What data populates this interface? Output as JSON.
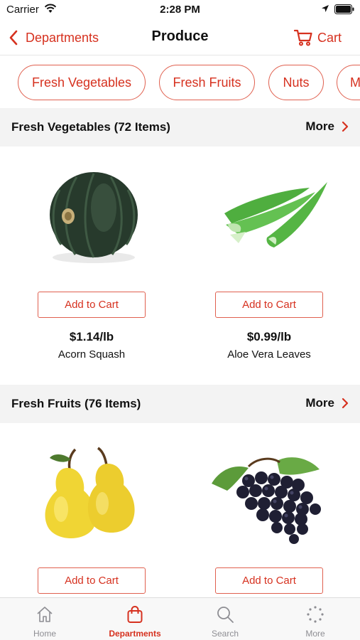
{
  "status": {
    "carrier": "Carrier",
    "time": "2:28 PM"
  },
  "nav": {
    "back_label": "Departments",
    "title": "Produce",
    "cart_label": "Cart"
  },
  "chips": [
    "Fresh Vegetables",
    "Fresh Fruits",
    "Nuts",
    "M"
  ],
  "sections": [
    {
      "title": "Fresh Vegetables (72 Items)",
      "more_label": "More",
      "products": [
        {
          "name": "Acorn Squash",
          "price": "$1.14/lb",
          "button": "Add to Cart",
          "image": "acorn-squash"
        },
        {
          "name": "Aloe Vera Leaves",
          "price": "$0.99/lb",
          "button": "Add to Cart",
          "image": "aloe-vera"
        }
      ]
    },
    {
      "title": "Fresh Fruits (76 Items)",
      "more_label": "More",
      "products": [
        {
          "button": "Add to Cart",
          "image": "pears"
        },
        {
          "button": "Add to Cart",
          "image": "grapes"
        }
      ]
    }
  ],
  "tabs": [
    {
      "label": "Home",
      "icon": "home-icon",
      "active": false
    },
    {
      "label": "Departments",
      "icon": "shopping-bag-icon",
      "active": true
    },
    {
      "label": "Search",
      "icon": "search-icon",
      "active": false
    },
    {
      "label": "More",
      "icon": "more-dots-icon",
      "active": false
    }
  ],
  "colors": {
    "accent": "#d6311f",
    "section_bg": "#f3f3f3",
    "tab_inactive": "#8e8e93"
  }
}
